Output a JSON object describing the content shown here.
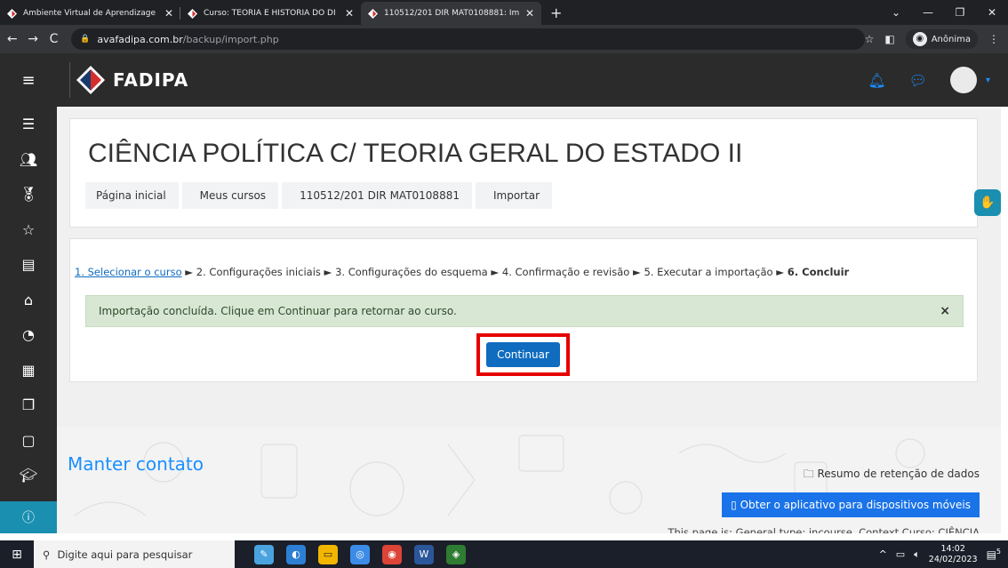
{
  "browser": {
    "tabs": [
      {
        "title": "Ambiente Virtual de Aprendizage",
        "active": false
      },
      {
        "title": "Curso: TEORIA E HISTÓRIA DO DI",
        "active": false
      },
      {
        "title": "110512/201 DIR MAT0108881: Im",
        "active": true
      }
    ],
    "url_host": "avafadipa.com.br",
    "url_path": "/backup/import.php",
    "profile_label": "Anônima"
  },
  "header": {
    "logo_text": "FADIPA"
  },
  "course": {
    "title": "CIÊNCIA POLÍTICA C/ TEORIA GERAL DO ESTADO II",
    "breadcrumbs": [
      "Página inicial",
      "Meus cursos",
      "110512/201 DIR MAT0108881",
      "Importar"
    ]
  },
  "import": {
    "step1": "1. Selecionar o curso",
    "step2": "2. Configurações iniciais",
    "step3": "3. Configurações do esquema",
    "step4": "4. Confirmação e revisão",
    "step5": "5. Executar a importação",
    "step6": "6. Concluir",
    "arrow": "►",
    "alert_text": "Importação concluída. Clique em Continuar para retornar ao curso.",
    "alert_close": "×",
    "continue_label": "Continuar"
  },
  "footer": {
    "contact_title": "Manter contato",
    "data_retention": "Resumo de retenção de dados",
    "mobile_app": "Obter o aplicativo para dispositivos móveis",
    "page_info": "This page is: General type: incourse. Context Curso: CIÊNCIA"
  },
  "taskbar": {
    "search_placeholder": "Digite aqui para pesquisar",
    "time": "14:02",
    "date": "24/02/2023",
    "notification_count": "5"
  },
  "colors": {
    "accent": "#0f6cbf",
    "highlight": "#e60000",
    "success_bg": "#d8e7d4"
  }
}
